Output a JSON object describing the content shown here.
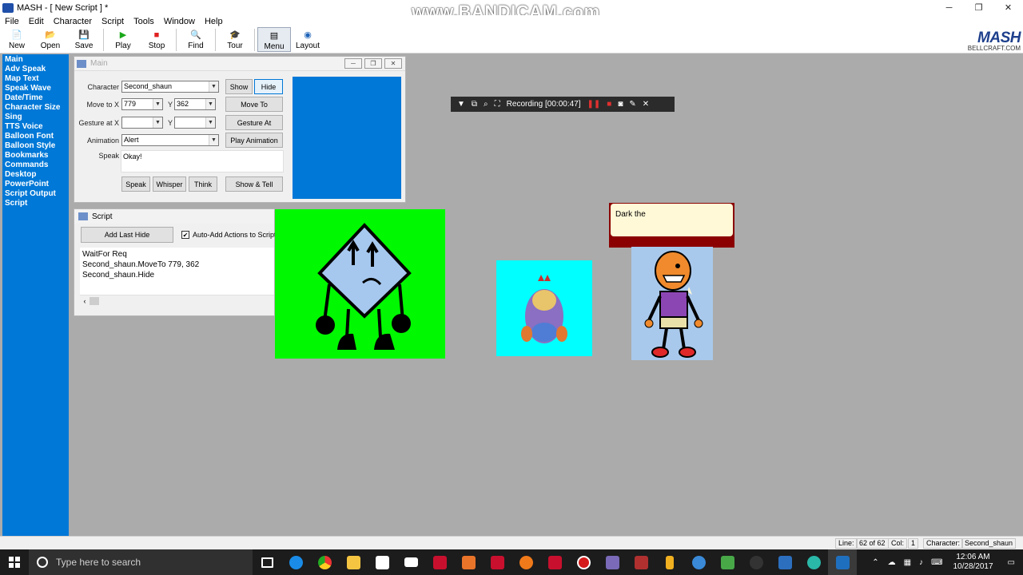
{
  "window": {
    "title": "MASH - [ New Script ] *",
    "minimize": "─",
    "maximize": "❐",
    "close": "✕"
  },
  "watermark": "www.BANDICAM.com",
  "menu": [
    "File",
    "Edit",
    "Character",
    "Script",
    "Tools",
    "Window",
    "Help"
  ],
  "toolbar": [
    {
      "label": "New",
      "icon": "new-file-icon",
      "glyph": "📄"
    },
    {
      "label": "Open",
      "icon": "folder-open-icon",
      "glyph": "📂"
    },
    {
      "label": "Save",
      "icon": "save-icon",
      "glyph": "💾"
    },
    {
      "label": "Play",
      "icon": "play-icon",
      "glyph": "▶",
      "color": "#1aa81a"
    },
    {
      "label": "Stop",
      "icon": "stop-icon",
      "glyph": "■",
      "color": "#e02020"
    },
    {
      "label": "Find",
      "icon": "find-icon",
      "glyph": "🔍"
    },
    {
      "label": "Tour",
      "icon": "tour-icon",
      "glyph": "🎓"
    },
    {
      "label": "Menu",
      "icon": "menu-icon",
      "glyph": "▤"
    },
    {
      "label": "Layout",
      "icon": "layout-icon",
      "glyph": "◉"
    }
  ],
  "brand": {
    "logo": "MASH",
    "sub": "BELLCRAFT.COM"
  },
  "nav": [
    "Main",
    "Adv Speak",
    "Map Text",
    "Speak Wave",
    "Date/Time",
    "Character Size",
    "Sing",
    "TTS Voice",
    "Balloon Font",
    "Balloon Style",
    "Bookmarks",
    "Commands",
    "Desktop",
    "PowerPoint",
    "Script Output",
    "Script"
  ],
  "main": {
    "title": "Main",
    "character_label": "Character",
    "character_value": "Second_shaun",
    "show": "Show",
    "hide": "Hide",
    "move_label": "Move to X",
    "move_x": "779",
    "y_label": "Y",
    "move_y": "362",
    "move_to": "Move To",
    "gesture_label": "Gesture at X",
    "gesture_x": "",
    "gesture_y": "",
    "gesture_at": "Gesture At",
    "animation_label": "Animation",
    "animation_value": "Alert",
    "play_animation": "Play Animation",
    "speak_label": "Speak",
    "speak_value": "Okay!",
    "btn_speak": "Speak",
    "btn_whisper": "Whisper",
    "btn_think": "Think",
    "btn_show_tell": "Show & Tell",
    "preview_color": "#0078d7"
  },
  "script": {
    "title": "Script",
    "add_last": "Add Last Hide",
    "auto_add": "Auto-Add Actions to Script",
    "auto_checked": "✔",
    "lines": [
      "WaitFor Req",
      "Second_shaun.MoveTo 779, 362",
      "Second_shaun.Hide"
    ]
  },
  "balloon_text": "Dark the",
  "recording": {
    "label": "Recording [00:00:47]"
  },
  "status": {
    "line_label": "Line:",
    "line_value": "62 of 62",
    "col_label": "Col:",
    "col_value": "1",
    "char_label": "Character:",
    "char_value": "Second_shaun"
  },
  "taskbar": {
    "search_placeholder": "Type here to search",
    "time": "12:06 AM",
    "date": "10/28/2017",
    "tray_arrow": "⌃",
    "colors": {
      "accent": "#0078d7",
      "taskbar": "#1c1c1c"
    }
  }
}
